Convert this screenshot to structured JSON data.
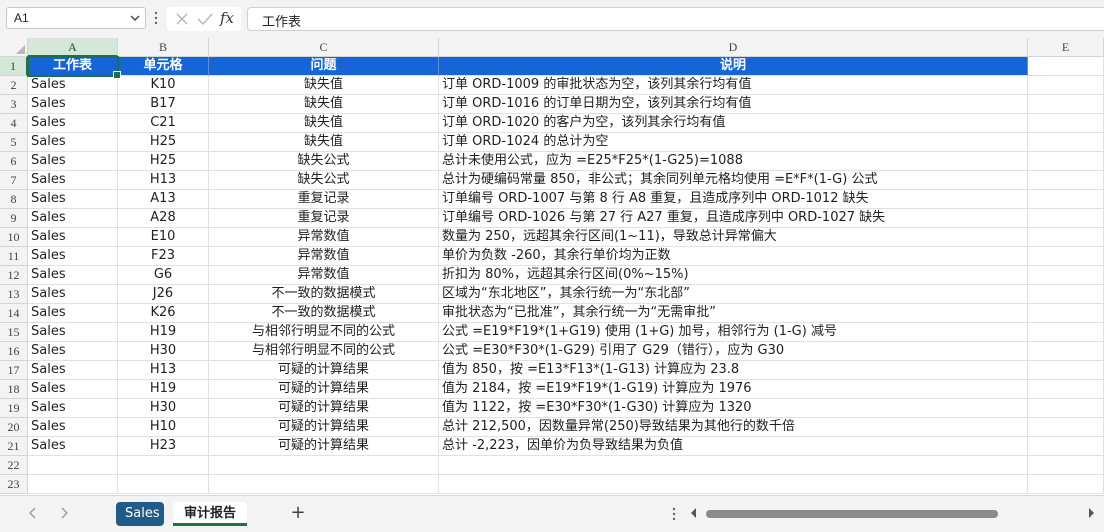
{
  "formula_bar": {
    "name_box": "A1",
    "fx_label": "fx",
    "content": "工作表"
  },
  "columns": [
    "A",
    "B",
    "C",
    "D",
    "E"
  ],
  "row_numbers": [
    "1",
    "2",
    "3",
    "4",
    "5",
    "6",
    "7",
    "8",
    "9",
    "10",
    "11",
    "12",
    "13",
    "14",
    "15",
    "16",
    "17",
    "18",
    "19",
    "20",
    "21",
    "22",
    "23"
  ],
  "table": {
    "headers": [
      "工作表",
      "单元格",
      "问题",
      "说明"
    ],
    "rows": [
      [
        "Sales",
        "K10",
        "缺失值",
        "订单 ORD-1009 的审批状态为空，该列其余行均有值"
      ],
      [
        "Sales",
        "B17",
        "缺失值",
        "订单 ORD-1016 的订单日期为空，该列其余行均有值"
      ],
      [
        "Sales",
        "C21",
        "缺失值",
        "订单 ORD-1020 的客户为空，该列其余行均有值"
      ],
      [
        "Sales",
        "H25",
        "缺失值",
        "订单 ORD-1024 的总计为空"
      ],
      [
        "Sales",
        "H25",
        "缺失公式",
        "总计未使用公式，应为 =E25*F25*(1-G25)=1088"
      ],
      [
        "Sales",
        "H13",
        "缺失公式",
        "总计为硬编码常量 850，非公式；其余同列单元格均使用 =E*F*(1-G) 公式"
      ],
      [
        "Sales",
        "A13",
        "重复记录",
        "订单编号 ORD-1007 与第 8 行 A8 重复，且造成序列中 ORD-1012 缺失"
      ],
      [
        "Sales",
        "A28",
        "重复记录",
        "订单编号 ORD-1026 与第 27 行 A27 重复，且造成序列中 ORD-1027 缺失"
      ],
      [
        "Sales",
        "E10",
        "异常数值",
        "数量为 250，远超其余行区间(1~11)，导致总计异常偏大"
      ],
      [
        "Sales",
        "F23",
        "异常数值",
        "单价为负数 -260，其余行单价均为正数"
      ],
      [
        "Sales",
        "G6",
        "异常数值",
        "折扣为 80%，远超其余行区间(0%~15%)"
      ],
      [
        "Sales",
        "J26",
        "不一致的数据模式",
        "区域为“东北地区”，其余行统一为“东北部”"
      ],
      [
        "Sales",
        "K26",
        "不一致的数据模式",
        "审批状态为“已批准”，其余行统一为“无需审批”"
      ],
      [
        "Sales",
        "H19",
        "与相邻行明显不同的公式",
        "公式 =E19*F19*(1+G19) 使用 (1+G) 加号，相邻行为 (1-G) 减号"
      ],
      [
        "Sales",
        "H30",
        "与相邻行明显不同的公式",
        "公式 =E30*F30*(1-G29) 引用了 G29（错行），应为 G30"
      ],
      [
        "Sales",
        "H13",
        "可疑的计算结果",
        "值为 850，按 =E13*F13*(1-G13) 计算应为 23.8"
      ],
      [
        "Sales",
        "H19",
        "可疑的计算结果",
        "值为 2184，按 =E19*F19*(1-G19) 计算应为 1976"
      ],
      [
        "Sales",
        "H30",
        "可疑的计算结果",
        "值为 1122，按 =E30*F30*(1-G30) 计算应为 1320"
      ],
      [
        "Sales",
        "H10",
        "可疑的计算结果",
        "总计 212,500，因数量异常(250)导致结果为其他行的数千倍"
      ],
      [
        "Sales",
        "H23",
        "可疑的计算结果",
        "总计 -2,223，因单价为负导致结果为负值"
      ]
    ]
  },
  "sheet_tabs": [
    {
      "label": "Sales"
    },
    {
      "label": "审计报告"
    }
  ],
  "add_sheet_label": "+",
  "colors": {
    "header_fill": "#1565d8",
    "selection_green": "#1e7145",
    "sales_tab": "#1f5c8a"
  }
}
